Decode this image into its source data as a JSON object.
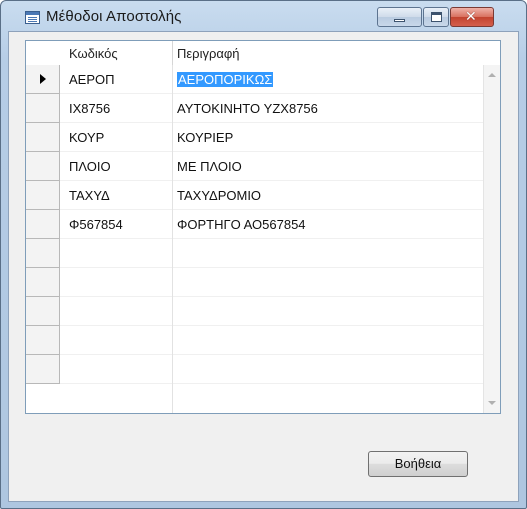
{
  "window": {
    "title": "Μέθοδοι Αποστολής",
    "icon": "table-window-icon"
  },
  "grid": {
    "columns": [
      "Κωδικός",
      "Περιγραφή"
    ],
    "rows": [
      {
        "code": "ΑΕΡΟΠ",
        "description": "ΑΕΡΟΠΟΡΙΚΩΣ",
        "current": true
      },
      {
        "code": "ΙΧ8756",
        "description": "ΑΥΤΟΚΙΝΗΤΟ YZX8756",
        "current": false
      },
      {
        "code": "ΚΟΥΡ",
        "description": "ΚΟΥΡΙΕΡ",
        "current": false
      },
      {
        "code": "ΠΛΟΙΟ",
        "description": "ΜΕ ΠΛΟΙΟ",
        "current": false
      },
      {
        "code": "ΤΑΧΥΔ",
        "description": "ΤΑΧΥΔΡΟΜΙΟ",
        "current": false
      },
      {
        "code": "Φ567854",
        "description": "ΦΟΡΤΗΓΟ ΑΟ567854",
        "current": false
      },
      {
        "code": "",
        "description": "",
        "current": false
      },
      {
        "code": "",
        "description": "",
        "current": false
      },
      {
        "code": "",
        "description": "",
        "current": false
      },
      {
        "code": "",
        "description": "",
        "current": false
      },
      {
        "code": "",
        "description": "",
        "current": false
      }
    ]
  },
  "buttons": {
    "help": "Βοήθεια"
  },
  "colors": {
    "selection": "#3399ff",
    "close_button": "#c2432f"
  }
}
